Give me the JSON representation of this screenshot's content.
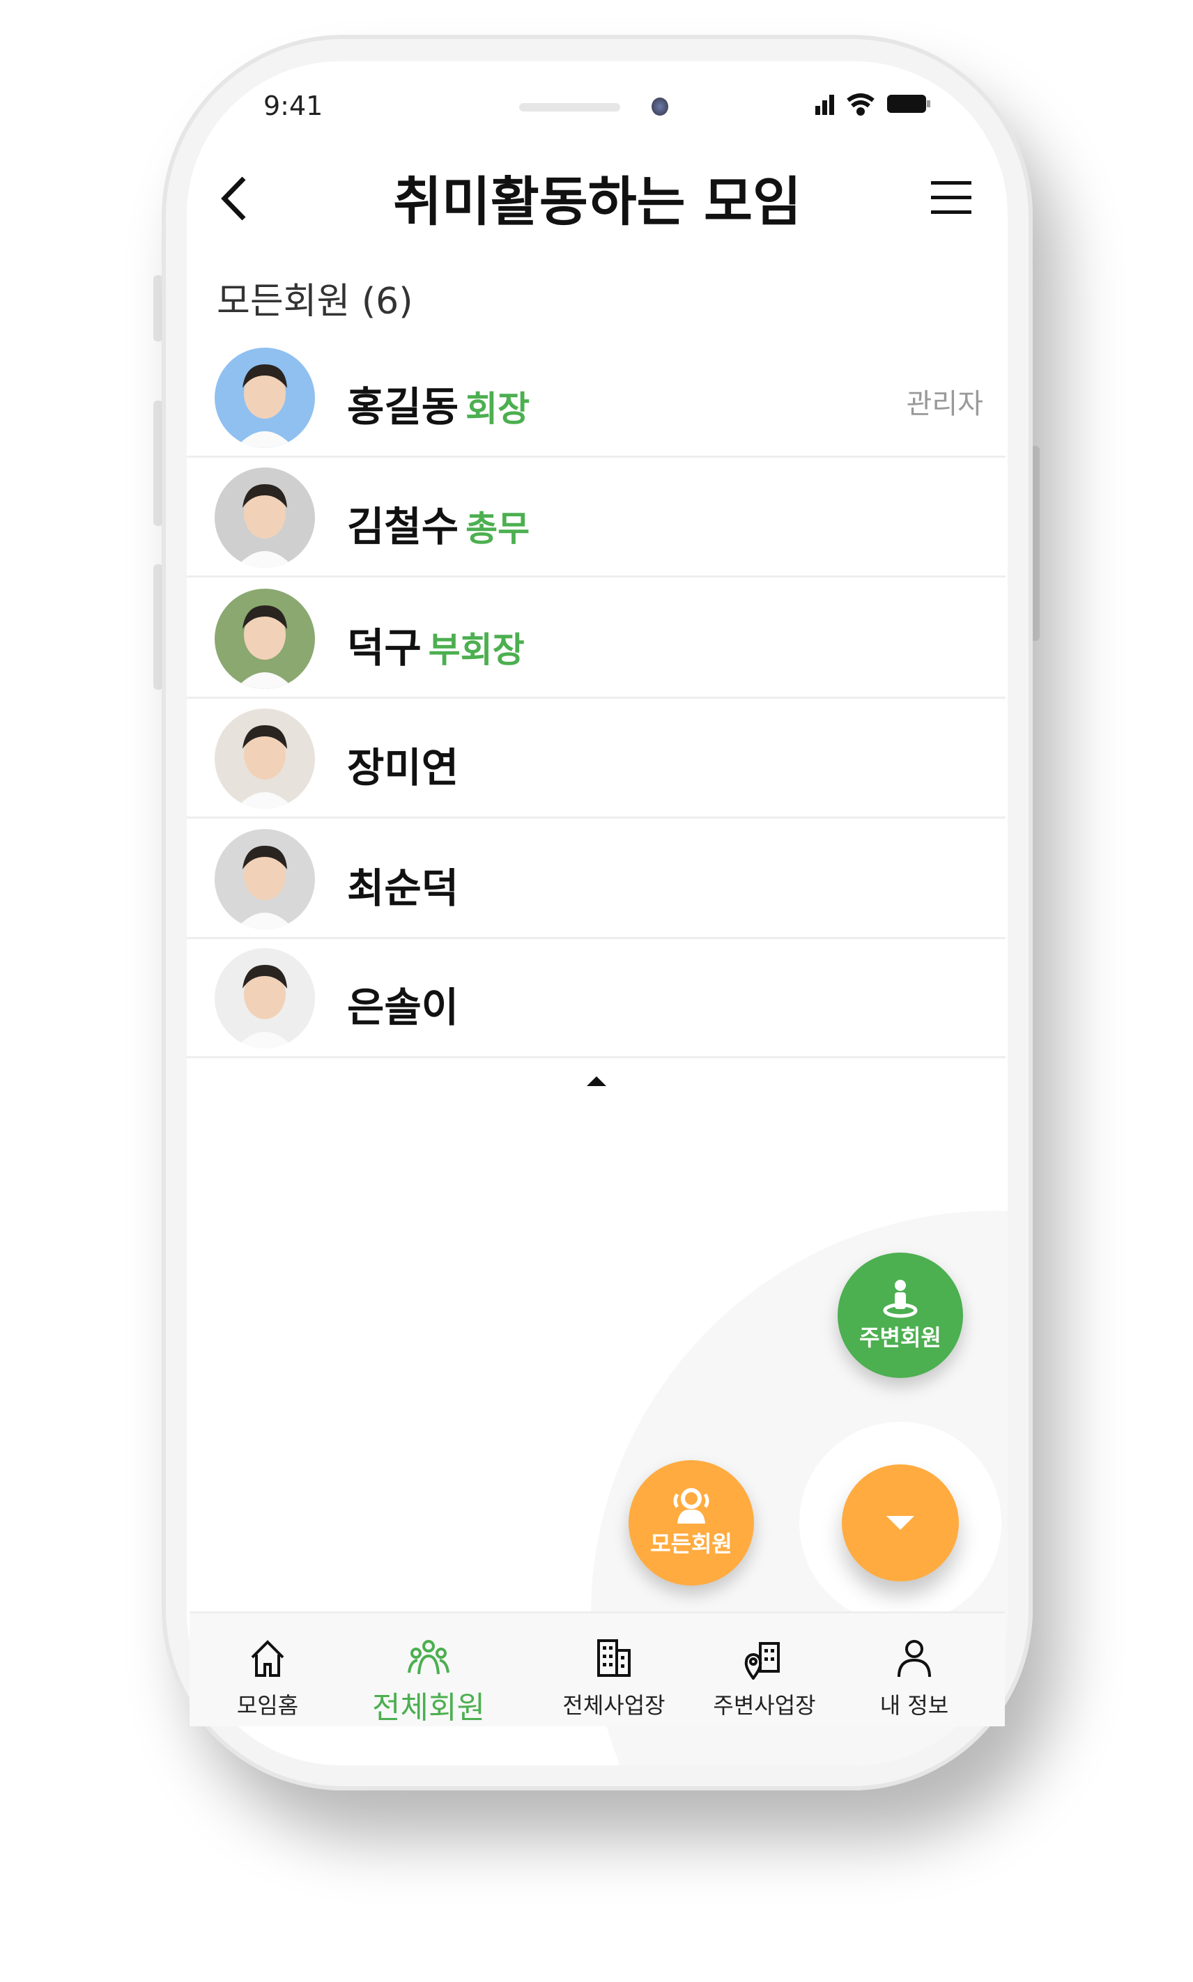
{
  "status_bar": {
    "time": "9:41"
  },
  "header": {
    "title": "취미활동하는 모임",
    "back_icon": "chevron-left-icon",
    "menu_icon": "hamburger-icon"
  },
  "section": {
    "label": "모든회원 (6)"
  },
  "members": [
    {
      "name": "홍길동",
      "role": "회장",
      "badge": "관리자",
      "avatar_bg": "#8fc0f0"
    },
    {
      "name": "김철수",
      "role": "총무",
      "badge": "",
      "avatar_bg": "#cfcfcf"
    },
    {
      "name": "덕구",
      "role": "부회장",
      "badge": "",
      "avatar_bg": "#8aa870"
    },
    {
      "name": "장미연",
      "role": "",
      "badge": "",
      "avatar_bg": "#e8e2dc"
    },
    {
      "name": "최순덕",
      "role": "",
      "badge": "",
      "avatar_bg": "#d8d8d8"
    },
    {
      "name": "은솔이",
      "role": "",
      "badge": "",
      "avatar_bg": "#eeeeee"
    }
  ],
  "fabs": {
    "nearby_label": "주변회원",
    "all_label": "모든회원"
  },
  "nav": {
    "items": [
      {
        "label": "모임홈",
        "icon": "home-icon",
        "active": false
      },
      {
        "label": "전체회원",
        "icon": "group-icon",
        "active": true
      },
      {
        "label": "전체사업장",
        "icon": "building-icon",
        "active": false
      },
      {
        "label": "주변사업장",
        "icon": "building-location-icon",
        "active": false
      },
      {
        "label": "내 정보",
        "icon": "person-icon",
        "active": false
      }
    ]
  },
  "colors": {
    "accent_green": "#4caf50",
    "accent_orange": "#ffab40",
    "role_green": "#4caf50"
  }
}
